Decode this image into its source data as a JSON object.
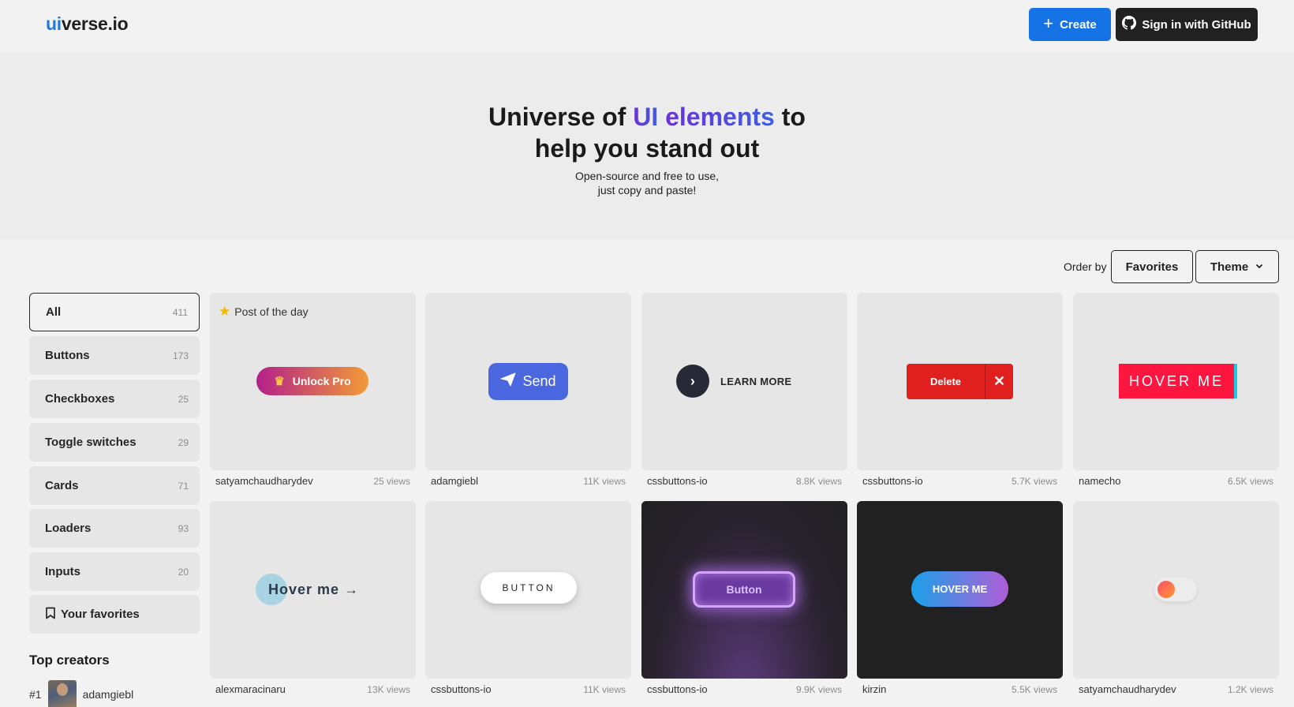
{
  "header": {
    "logo_ui": "ui",
    "logo_rest": "verse.io",
    "create_label": "Create",
    "github_label": "Sign in with GitHub"
  },
  "hero": {
    "title_part1": "Universe of ",
    "title_ui": "UI",
    "title_elements": " elements",
    "title_part2": " to",
    "title_line2": "help you stand out",
    "sub_line1": "Open-source and free to use,",
    "sub_line2": "just copy and paste!"
  },
  "order": {
    "label": "Order by",
    "favorites": "Favorites",
    "theme": "Theme"
  },
  "sidebar": {
    "items": [
      {
        "label": "All",
        "count": "411"
      },
      {
        "label": "Buttons",
        "count": "173"
      },
      {
        "label": "Checkboxes",
        "count": "25"
      },
      {
        "label": "Toggle switches",
        "count": "29"
      },
      {
        "label": "Cards",
        "count": "71"
      },
      {
        "label": "Loaders",
        "count": "93"
      },
      {
        "label": "Inputs",
        "count": "20"
      }
    ],
    "favorites": "Your favorites",
    "top_creators_title": "Top creators",
    "creator_rank": "#1",
    "creator_name": "adamgiebl"
  },
  "cards": [
    {
      "author": "satyamchaudharydev",
      "views": "25 views",
      "badge": "Post of the day",
      "preview": "Unlock Pro"
    },
    {
      "author": "adamgiebl",
      "views": "11K views",
      "preview": "Send"
    },
    {
      "author": "cssbuttons-io",
      "views": "8.8K views",
      "preview": "LEARN MORE"
    },
    {
      "author": "cssbuttons-io",
      "views": "5.7K views",
      "preview": "Delete"
    },
    {
      "author": "namecho",
      "views": "6.5K views",
      "preview": "HOVER ME"
    },
    {
      "author": "alexmaracinaru",
      "views": "13K views",
      "preview": "Hover me"
    },
    {
      "author": "cssbuttons-io",
      "views": "11K views",
      "preview": "BUTTON"
    },
    {
      "author": "cssbuttons-io",
      "views": "9.9K views",
      "preview": "Button"
    },
    {
      "author": "kirzin",
      "views": "5.5K views",
      "preview": "HOVER ME"
    },
    {
      "author": "satyamchaudharydev",
      "views": "1.2K views",
      "preview": ""
    }
  ],
  "colors": {
    "brand_blue": "#1573e6",
    "github_dark": "#212121",
    "title_purple": "#6b2fd6",
    "title_blue": "#3f5fe0"
  }
}
